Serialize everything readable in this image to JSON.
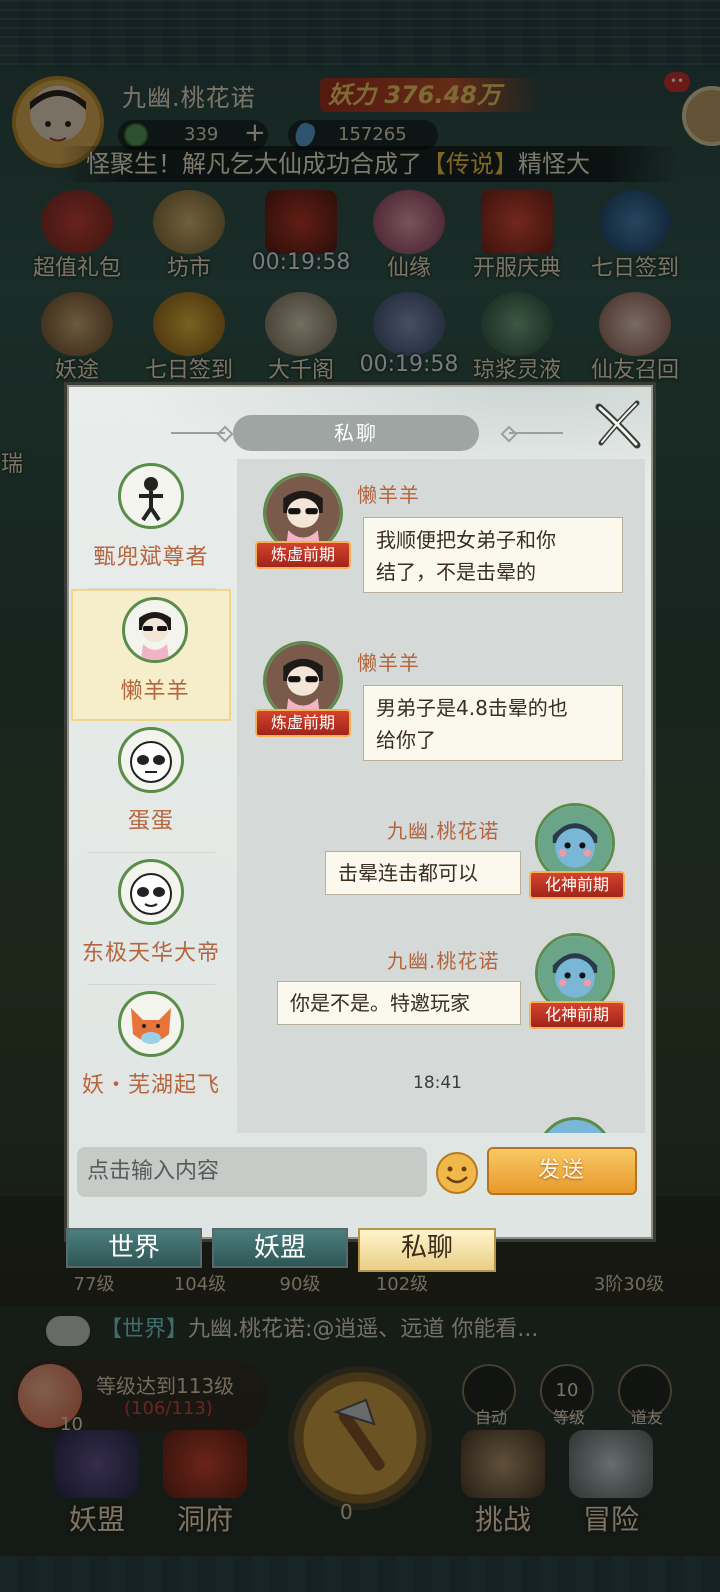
{
  "hud": {
    "player_name": "九幽.桃花诺",
    "power": "妖力 376.48万",
    "coins": "339",
    "plus": "+",
    "gems": "157265",
    "notif": "••",
    "marquee_a": "怪聚生！解凡乞大仙成功合成了",
    "marquee_b": "【传说】",
    "marquee_c": "精怪大",
    "icons_row1": [
      "超值礼包",
      "坊市",
      "00:19:58",
      "仙缘",
      "开服庆典",
      "七日签到"
    ],
    "icons_row2": [
      "妖途",
      "七日签到",
      "大千阁",
      "00:19:58",
      "琼浆灵液",
      "仙友召回"
    ],
    "left_cut": "瑞",
    "levels": [
      "77级",
      "104级",
      "90级",
      "102级",
      "3阶30级"
    ],
    "chat_ticker_tag": "【世界】",
    "chat_ticker_text": "九幽.桃花诺:@逍遥、远道 你能看...",
    "level_goal": "等级达到113级",
    "level_progress": "(106/113)",
    "level_num": "10",
    "axe_count": "0",
    "round_buttons": [
      {
        "icon": "",
        "label": "自动"
      },
      {
        "icon": "10",
        "label": "等级"
      },
      {
        "icon": "",
        "label": "道友"
      }
    ],
    "bottom_nav": [
      "妖盟",
      "洞府",
      "挑战",
      "冒险"
    ]
  },
  "dialog": {
    "title": "私聊",
    "close_label": "✕",
    "contacts": [
      {
        "name": "甄兜斌尊者",
        "selected": false
      },
      {
        "name": "懒羊羊",
        "selected": true
      },
      {
        "name": "蛋蛋",
        "selected": false
      },
      {
        "name": "东极天华大帝",
        "selected": false
      },
      {
        "name": "妖・芜湖起飞",
        "selected": false
      }
    ],
    "messages": [
      {
        "sender": "懒羊羊",
        "rank": "炼虚前期",
        "text_l1": "我顺便把女弟子和你",
        "text_l2": "结了，不是击晕的",
        "side": "left"
      },
      {
        "sender": "懒羊羊",
        "rank": "炼虚前期",
        "text_l1": "男弟子是4.8击晕的也",
        "text_l2": "给你了",
        "side": "left"
      },
      {
        "sender": "九幽.桃花诺",
        "rank": "化神前期",
        "text": "击晕连击都可以",
        "side": "right"
      },
      {
        "sender": "九幽.桃花诺",
        "rank": "化神前期",
        "text": "你是不是。特邀玩家",
        "side": "right"
      }
    ],
    "timestamp": "18:41",
    "input_placeholder": "点击输入内容",
    "send_label": "发送"
  },
  "tabs": [
    "世界",
    "妖盟",
    "私聊"
  ],
  "colors": {
    "accent_orange": "#e89a2c",
    "name_brown": "#b5653e",
    "rank_red": "#c0341f",
    "avatar_ring": "#5a8d4a"
  }
}
